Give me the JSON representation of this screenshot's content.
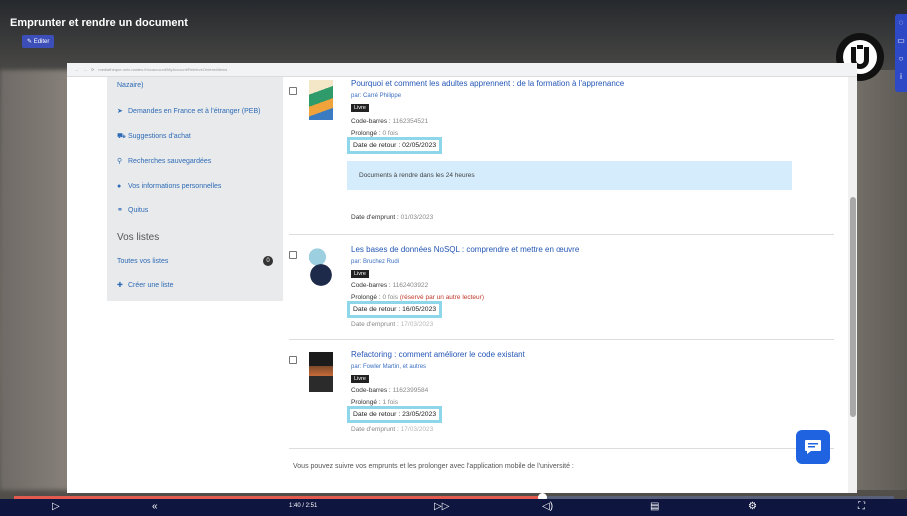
{
  "video": {
    "title": "Emprunter et rendre un document",
    "edit_label": "Editer",
    "time": "1:40 / 2:51",
    "progress_fraction": 0.6
  },
  "browser": {
    "url": "mediatheque.univ-nantes.fr/ccaccount/MyAccount/RetrieveOrderedItems"
  },
  "sidebar": {
    "top_partial": "Nazaire)",
    "items": [
      {
        "label": "Demandes en France et à l'étranger (PEB)",
        "icon": "paper-plane-icon"
      },
      {
        "label": "Suggestions d'achat",
        "icon": "cart-icon"
      },
      {
        "label": "Recherches sauvegardées",
        "icon": "search-icon"
      },
      {
        "label": "Vos informations personnelles",
        "icon": "user-icon"
      },
      {
        "label": "Quitus",
        "icon": "handshake-icon"
      }
    ],
    "lists_heading": "Vos listes",
    "all_lists": "Toutes vos listes",
    "all_lists_count": "0",
    "create_list": "Créer une liste"
  },
  "documents": [
    {
      "title": "Pourquoi et comment les adultes apprennent : de la formation à l'apprenance",
      "author": "par: Carré Philippe",
      "type": "Livre",
      "barcode_label": "Code-barres :",
      "barcode": "1162354521",
      "extended_label": "Prolongé :",
      "extended": "0 fois",
      "due_label": "Date de retour :",
      "due": "02/05/2023",
      "alert": "Documents à rendre dans les 24 heures",
      "borrow_label": "Date d'emprunt :",
      "borrow": "01/03/2023"
    },
    {
      "title": "Les bases de données NoSQL : comprendre et mettre en œuvre",
      "author": "par: Bruchez Rudi",
      "type": "Livre",
      "barcode_label": "Code-barres :",
      "barcode": "1162403922",
      "extended_label": "Prolongé :",
      "extended": "0 fois",
      "extended_note": "(réservé par un autre lecteur)",
      "due_label": "Date de retour :",
      "due": "16/05/2023",
      "borrow_label": "Date d'emprunt :",
      "borrow": "17/03/2023"
    },
    {
      "title": "Refactoring : comment améliorer le code existant",
      "author": "par: Fowler Martin, et autres",
      "type": "Livre",
      "barcode_label": "Code-barres :",
      "barcode": "1162399584",
      "extended_label": "Prolongé :",
      "extended": "1 fois",
      "due_label": "Date de retour :",
      "due": "23/05/2023",
      "borrow_label": "Date d'emprunt :",
      "borrow": "17/03/2023"
    }
  ],
  "footer": {
    "text": "Vous pouvez suivre vos emprunts et les prolonger avec l'application mobile de l'université :"
  },
  "colors": {
    "highlight": "#8ed6ea",
    "link": "#2456b4",
    "alert_bg": "#d4ecfb",
    "player_bar": "#0e1640",
    "progress": "#e35b4f"
  }
}
